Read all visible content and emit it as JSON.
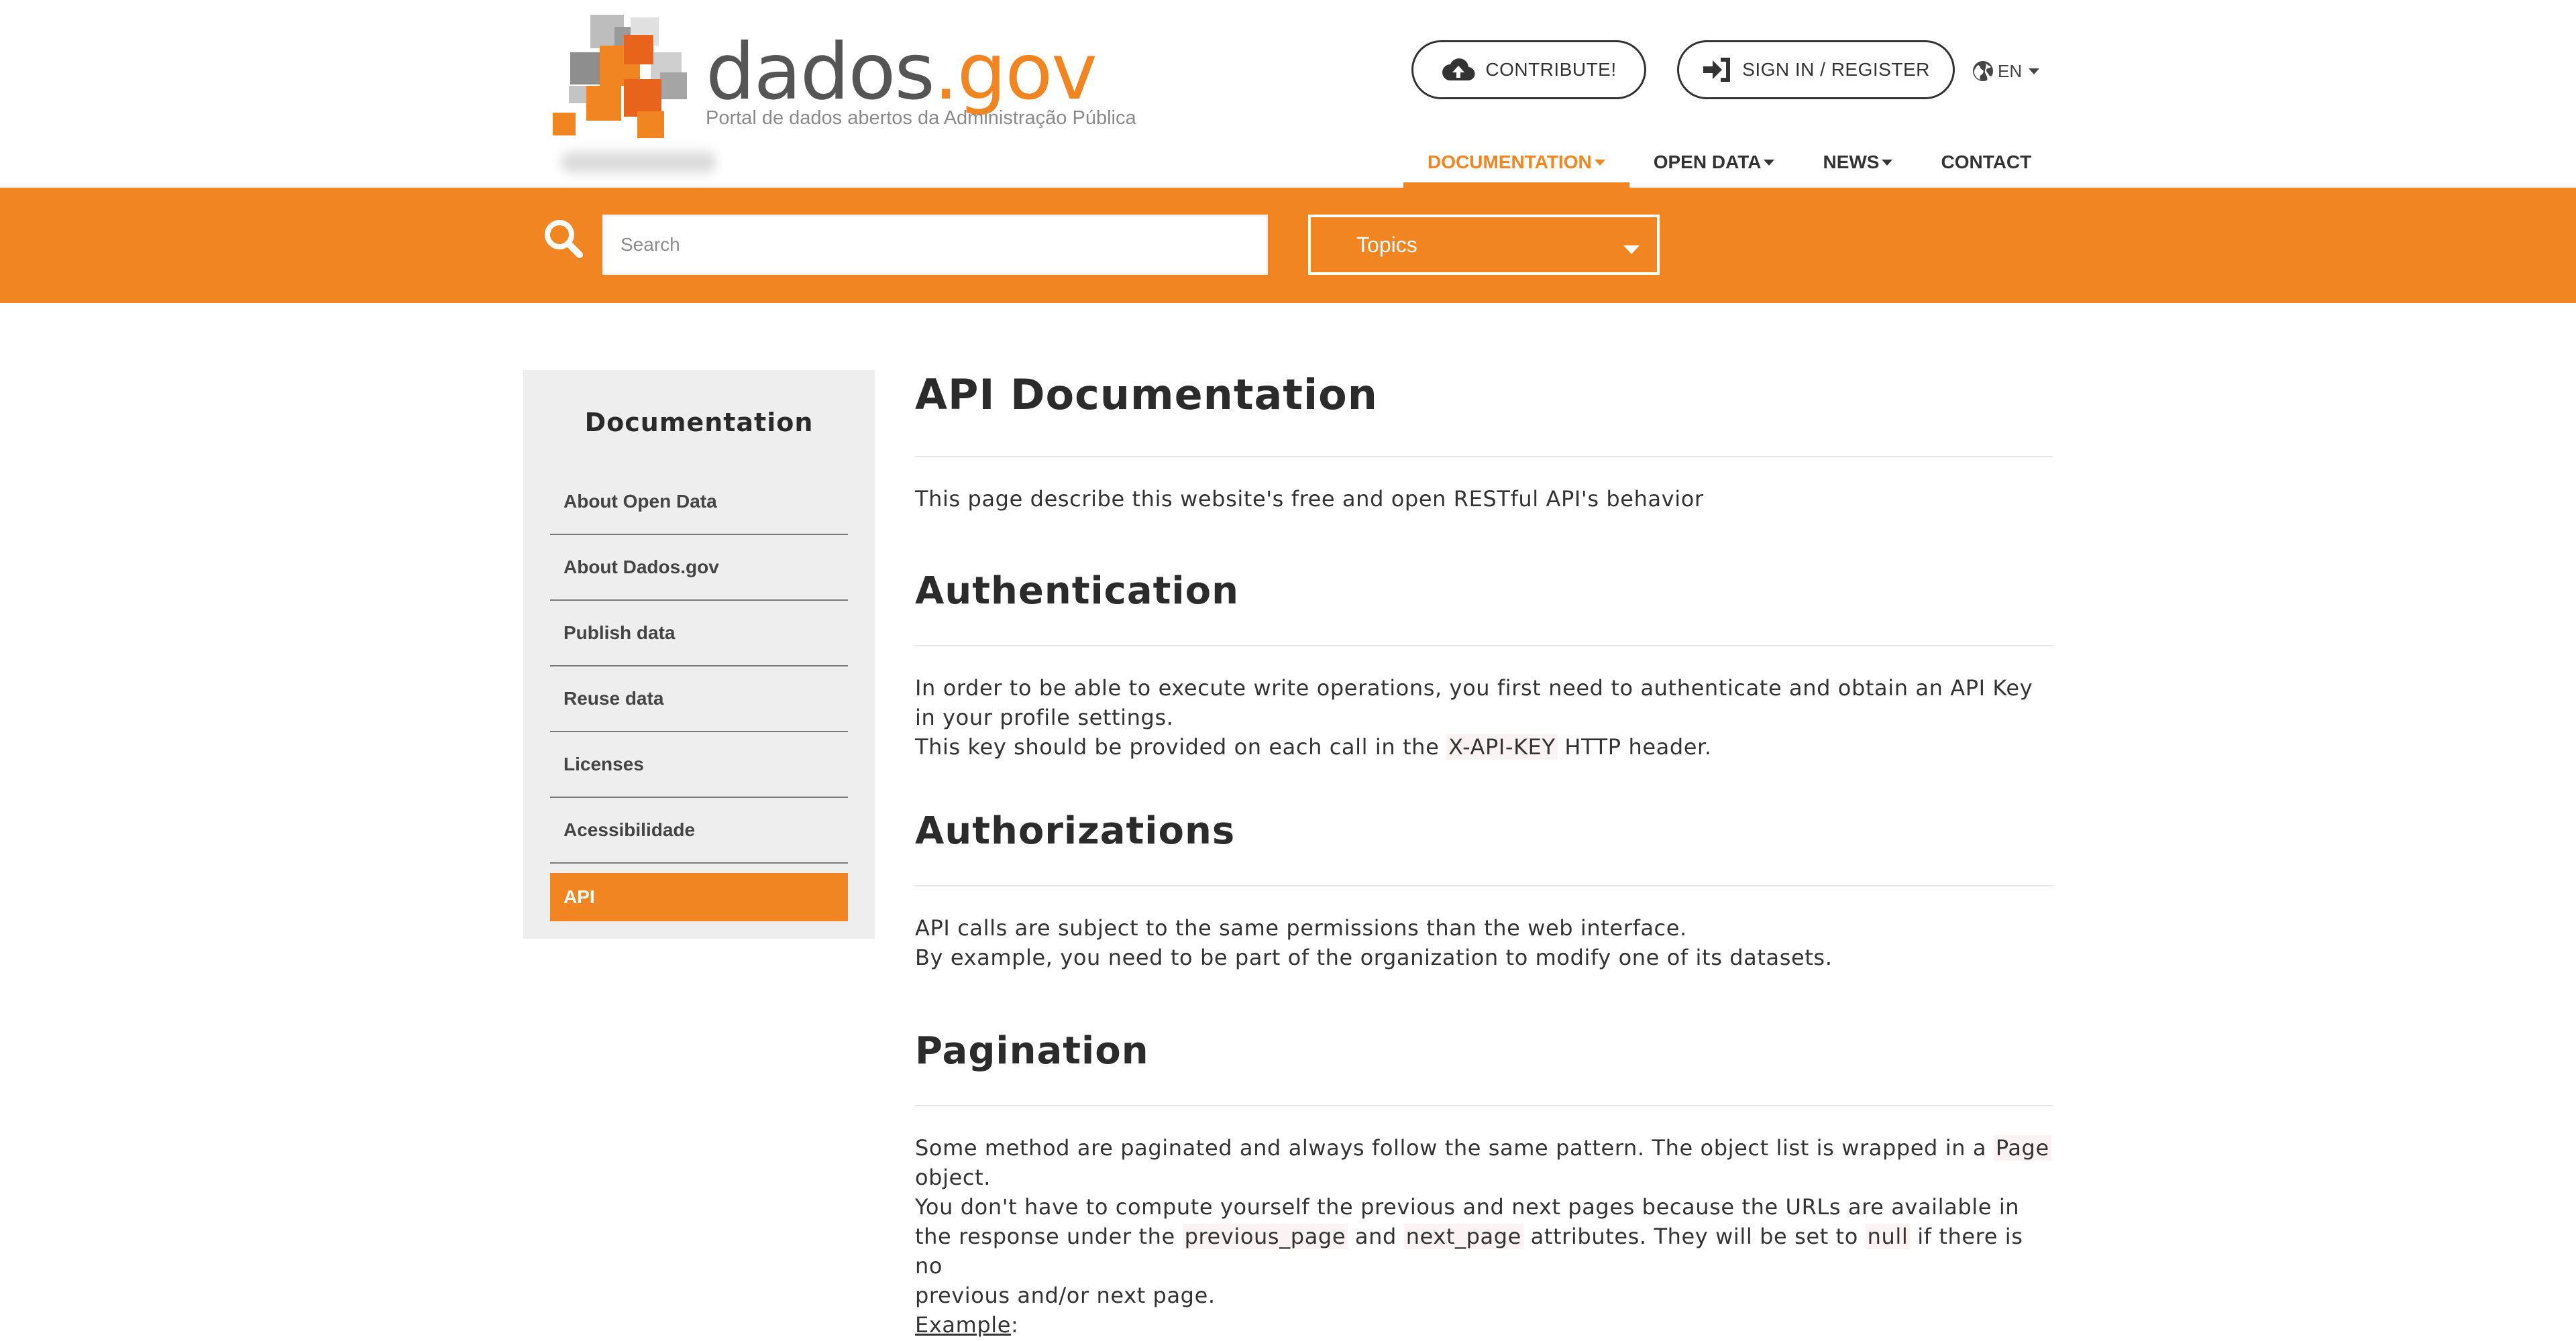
{
  "logo": {
    "word_main": "dados",
    "word_accent": ".gov",
    "tagline": "Portal de dados abertos da Administração Pública"
  },
  "header": {
    "contribute_label": "CONTRIBUTE!",
    "signin_label": "SIGN IN / REGISTER",
    "language": "EN"
  },
  "nav": {
    "items": [
      {
        "label": "DOCUMENTATION",
        "active": true,
        "dropdown": true
      },
      {
        "label": "OPEN DATA",
        "active": false,
        "dropdown": true
      },
      {
        "label": "NEWS",
        "active": false,
        "dropdown": true
      },
      {
        "label": "CONTACT",
        "active": false,
        "dropdown": false
      }
    ]
  },
  "search": {
    "placeholder": "Search",
    "topics_label": "Topics"
  },
  "sidebar": {
    "title": "Documentation",
    "items": [
      {
        "label": "About Open Data"
      },
      {
        "label": "About Dados.gov"
      },
      {
        "label": "Publish data"
      },
      {
        "label": "Reuse data"
      },
      {
        "label": "Licenses"
      },
      {
        "label": "Acessibilidade"
      },
      {
        "label": "API",
        "active": true
      }
    ]
  },
  "content": {
    "title": "API Documentation",
    "intro": "This page describe this website's free and open RESTful API's behavior",
    "authentication": {
      "heading": "Authentication",
      "line1": "In order to be able to execute write operations, you first need to authenticate and obtain an API Key",
      "line2": "in your profile settings.",
      "line3_before": "This key should be provided on each call in the ",
      "line3_code": "X-API-KEY",
      "line3_after": " HTTP header."
    },
    "authorizations": {
      "heading": "Authorizations",
      "line1": "API calls are subject to the same permissions than the web interface.",
      "line2": "By example, you need to be part of the organization to modify one of its datasets."
    },
    "pagination": {
      "heading": "Pagination",
      "line1_before": "Some method are paginated and always follow the same pattern. The object list is wrapped in a ",
      "line1_code": "Page",
      "line2": "object.",
      "line3": "You don't have to compute yourself the previous and next pages because the URLs are available in",
      "line4_a": "the response under the ",
      "line4_code1": "previous_page",
      "line4_b": " and ",
      "line4_code2": "next_page",
      "line4_c": " attributes. They will be set to ",
      "line4_code3": "null",
      "line4_d": " if there is no",
      "line5": "previous and/or next page.",
      "example_label": "Example",
      "example_colon": ":"
    }
  },
  "colors": {
    "accent": "#f08521",
    "text": "#333333",
    "sidebar_bg": "#eeeeee"
  },
  "icons": {
    "contribute": "cloud-upload-icon",
    "signin": "sign-in-icon",
    "language": "globe-icon",
    "search": "search-icon"
  }
}
